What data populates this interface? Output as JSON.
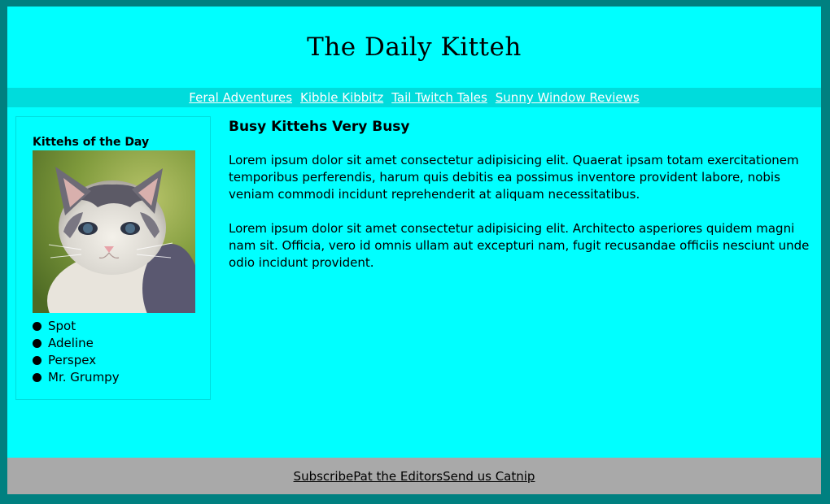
{
  "masthead": {
    "title": "The Daily Kitteh"
  },
  "nav": {
    "links": [
      "Feral Adventures",
      "Kibble Kibbitz",
      "Tail Twitch Tales",
      "Sunny Window Reviews"
    ]
  },
  "sidebar": {
    "heading": "Kittehs of the Day",
    "kittens": [
      "Spot",
      "Adeline",
      "Perspex",
      "Mr. Grumpy"
    ]
  },
  "article": {
    "heading": "Busy Kittehs Very Busy",
    "paragraphs": [
      "Lorem ipsum dolor sit amet consectetur adipisicing elit. Quaerat ipsam totam exercitationem temporibus perferendis, harum quis debitis ea possimus inventore provident labore, nobis veniam commodi incidunt reprehenderit at aliquam necessitatibus.",
      "Lorem ipsum dolor sit amet consectetur adipisicing elit. Architecto asperiores quidem magni nam sit. Officia, vero id omnis ullam aut excepturi nam, fugit recusandae officiis nesciunt unde odio incidunt provident."
    ]
  },
  "footer": {
    "links": [
      "Subscribe",
      "Pat the Editors",
      "Send us Catnip"
    ]
  },
  "colors": {
    "page_background": "#00ffff",
    "outer_frame": "#008080",
    "nav_bar": "#00dcdc",
    "footer_bar": "#a9a9a9"
  }
}
